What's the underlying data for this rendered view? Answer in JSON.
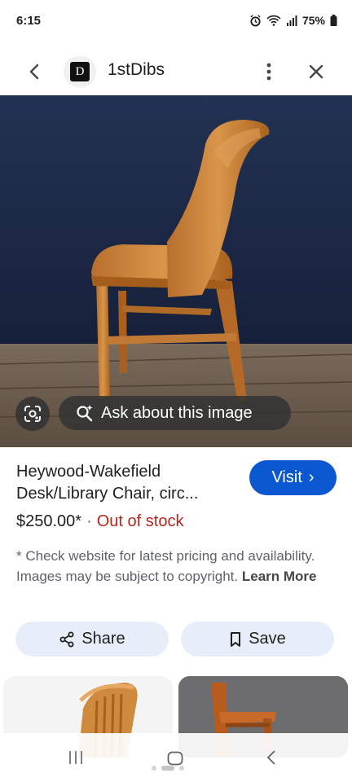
{
  "status_bar": {
    "time": "6:15",
    "battery": "75%"
  },
  "header": {
    "site_name": "1stDibs",
    "logo_letter": "D"
  },
  "image": {
    "ask_label": "Ask about this image",
    "colors": {
      "wall": "#1d2a44",
      "floor": "#6b5d4f",
      "wood": "#c9823a"
    }
  },
  "listing": {
    "title": "Heywood-Wakefield Desk/Library Chair, circ...",
    "price": "$250.00*",
    "separator": "·",
    "stock_status": "Out of stock",
    "disclaimer": "* Check website for latest pricing and availability. Images may be subject to copyright.",
    "learn_more": "Learn More",
    "visit_label": "Visit",
    "visit_chevron": "›"
  },
  "actions": {
    "share_label": "Share",
    "save_label": "Save"
  },
  "colors": {
    "accent": "#0b57d0",
    "out_of_stock": "#b3261e",
    "action_bg": "#e8eef9"
  },
  "icons": {
    "back": "chevron-left-icon",
    "more": "more-vert-icon",
    "close": "close-icon",
    "lens": "lens-icon",
    "ask": "search-sparkle-icon",
    "share": "share-icon",
    "save": "bookmark-icon"
  }
}
